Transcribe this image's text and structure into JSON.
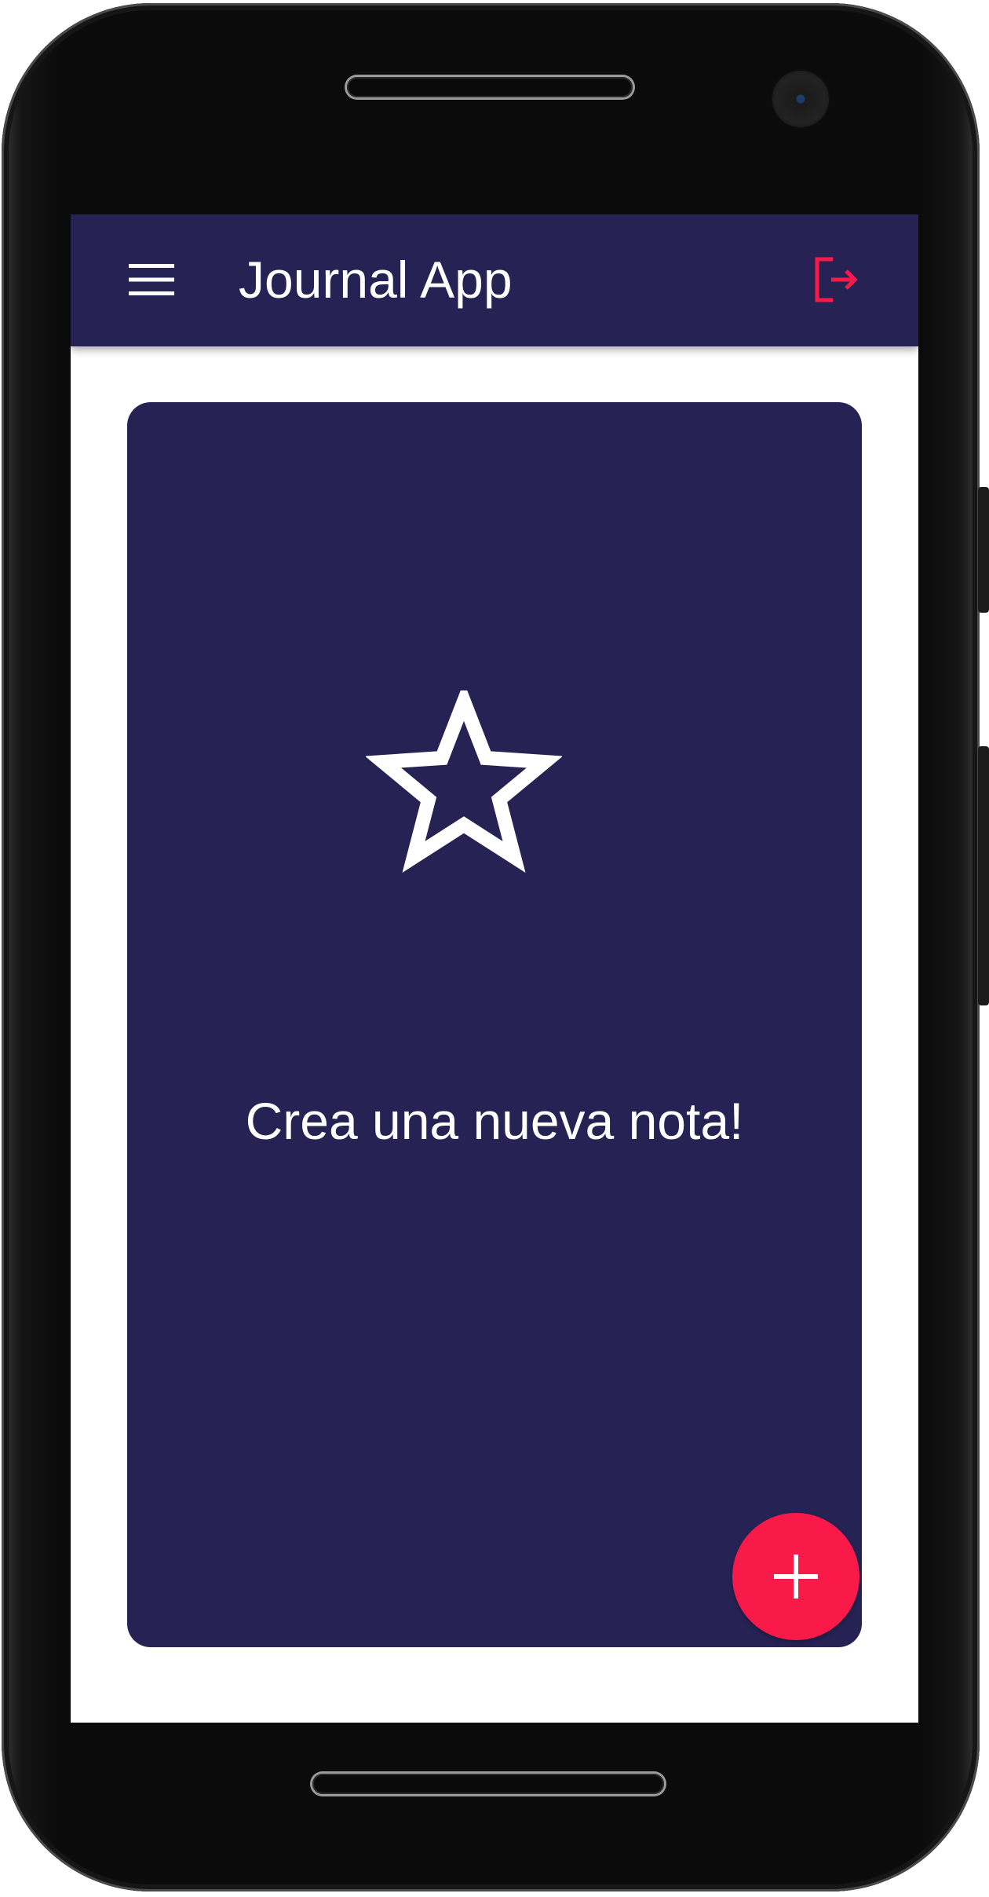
{
  "app_bar": {
    "title": "Journal App",
    "menu_icon": "hamburger-menu-icon",
    "logout_icon": "logout-icon",
    "background_color": "#262254",
    "logout_color": "#fa1a4a"
  },
  "main": {
    "empty_state": {
      "icon": "star-outline-icon",
      "message": "Crea una nueva nota!"
    },
    "card_color": "#262254"
  },
  "fab": {
    "icon": "add-icon",
    "color": "#fa1a4a"
  }
}
